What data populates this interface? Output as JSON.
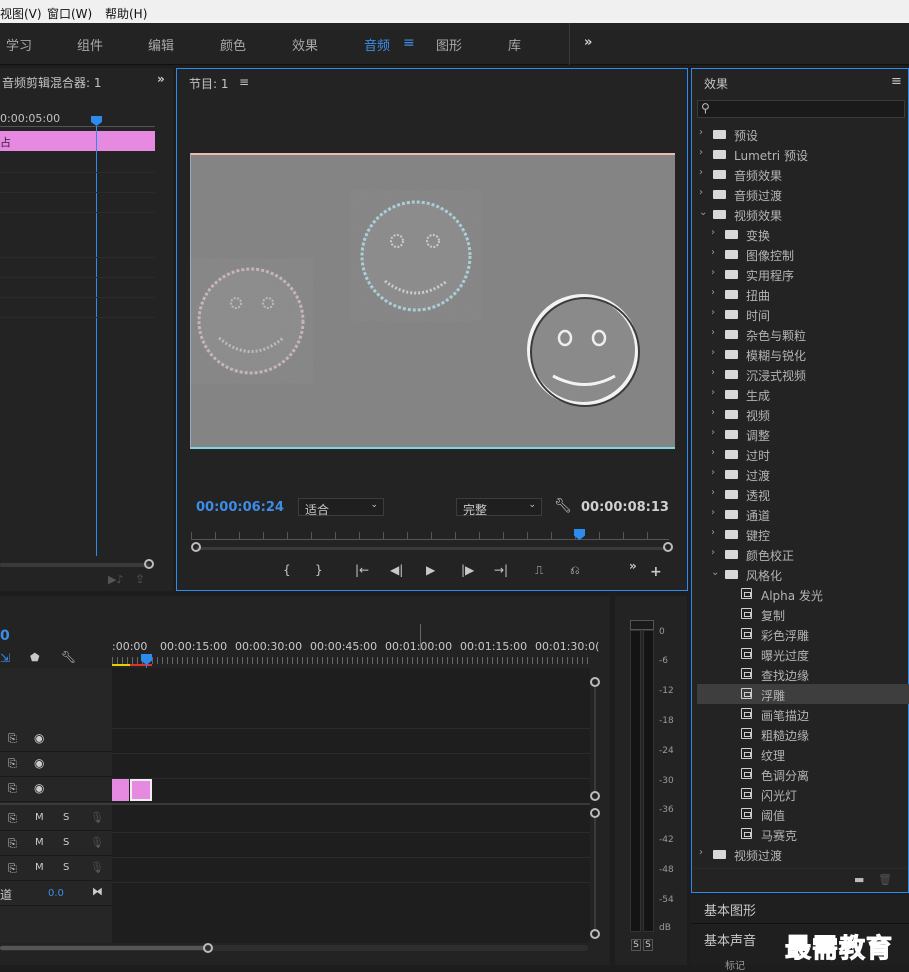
{
  "menubar": {
    "items": [
      "视图(V)",
      "窗口(W)",
      "帮助(H)"
    ]
  },
  "workspace": {
    "tabs": [
      "学习",
      "组件",
      "编辑",
      "颜色",
      "效果",
      "音频",
      "图形",
      "库"
    ],
    "active_tab": "音频",
    "menu_icon": "≡",
    "overflow_icon": "»"
  },
  "audio_mixer": {
    "title": "音频剪辑混合器: 1",
    "timecode": "0:00:05:00",
    "clip_label": "占"
  },
  "program_monitor": {
    "title": "节目: 1",
    "menu_icon": "≡",
    "current_timecode": "00:00:06:24",
    "zoom_select": "适合",
    "quality_select": "完整",
    "duration_timecode": "00:00:08:13",
    "controls": [
      "{",
      "}",
      "|←",
      "◀|",
      "▶",
      "|▶",
      "→|",
      "⎍",
      "⎌",
      "»",
      "+"
    ]
  },
  "timeline": {
    "timecode_fragment": "0",
    "ruler_labels": [
      ":00:00",
      "00:00:15:00",
      "00:00:30:00",
      "00:00:45:00",
      "00:01:00:00",
      "00:01:15:00",
      "00:01:30:0("
    ],
    "audio_track_buttons": [
      "M",
      "S"
    ],
    "master_label": "道",
    "master_value": "0.0"
  },
  "audio_meter": {
    "scale": [
      "0",
      "-6",
      "-12",
      "-18",
      "-24",
      "-30",
      "-36",
      "-42",
      "-48",
      "-54",
      "dB"
    ],
    "solo_buttons": [
      "S",
      "S"
    ]
  },
  "effects_panel": {
    "title": "效果",
    "menu_icon": "≡",
    "search_placeholder": "",
    "tree": [
      {
        "label": "预设",
        "level": 0,
        "kind": "folder-star",
        "expanded": false
      },
      {
        "label": "Lumetri 预设",
        "level": 0,
        "kind": "folder-star",
        "expanded": false
      },
      {
        "label": "音频效果",
        "level": 0,
        "kind": "folder",
        "expanded": false
      },
      {
        "label": "音频过渡",
        "level": 0,
        "kind": "folder",
        "expanded": false
      },
      {
        "label": "视频效果",
        "level": 0,
        "kind": "folder",
        "expanded": true
      },
      {
        "label": "变换",
        "level": 1,
        "kind": "folder",
        "expanded": false
      },
      {
        "label": "图像控制",
        "level": 1,
        "kind": "folder",
        "expanded": false
      },
      {
        "label": "实用程序",
        "level": 1,
        "kind": "folder",
        "expanded": false
      },
      {
        "label": "扭曲",
        "level": 1,
        "kind": "folder",
        "expanded": false
      },
      {
        "label": "时间",
        "level": 1,
        "kind": "folder",
        "expanded": false
      },
      {
        "label": "杂色与颗粒",
        "level": 1,
        "kind": "folder",
        "expanded": false
      },
      {
        "label": "模糊与锐化",
        "level": 1,
        "kind": "folder",
        "expanded": false
      },
      {
        "label": "沉浸式视频",
        "level": 1,
        "kind": "folder",
        "expanded": false
      },
      {
        "label": "生成",
        "level": 1,
        "kind": "folder",
        "expanded": false
      },
      {
        "label": "视频",
        "level": 1,
        "kind": "folder",
        "expanded": false
      },
      {
        "label": "调整",
        "level": 1,
        "kind": "folder",
        "expanded": false
      },
      {
        "label": "过时",
        "level": 1,
        "kind": "folder",
        "expanded": false
      },
      {
        "label": "过渡",
        "level": 1,
        "kind": "folder",
        "expanded": false
      },
      {
        "label": "透视",
        "level": 1,
        "kind": "folder",
        "expanded": false
      },
      {
        "label": "通道",
        "level": 1,
        "kind": "folder",
        "expanded": false
      },
      {
        "label": "键控",
        "level": 1,
        "kind": "folder",
        "expanded": false
      },
      {
        "label": "颜色校正",
        "level": 1,
        "kind": "folder",
        "expanded": false
      },
      {
        "label": "风格化",
        "level": 1,
        "kind": "folder",
        "expanded": true
      },
      {
        "label": "Alpha 发光",
        "level": 2,
        "kind": "effect"
      },
      {
        "label": "复制",
        "level": 2,
        "kind": "effect"
      },
      {
        "label": "彩色浮雕",
        "level": 2,
        "kind": "effect"
      },
      {
        "label": "曝光过度",
        "level": 2,
        "kind": "effect"
      },
      {
        "label": "查找边缘",
        "level": 2,
        "kind": "effect"
      },
      {
        "label": "浮雕",
        "level": 2,
        "kind": "effect",
        "selected": true
      },
      {
        "label": "画笔描边",
        "level": 2,
        "kind": "effect"
      },
      {
        "label": "粗糙边缘",
        "level": 2,
        "kind": "effect"
      },
      {
        "label": "纹理",
        "level": 2,
        "kind": "effect"
      },
      {
        "label": "色调分离",
        "level": 2,
        "kind": "effect"
      },
      {
        "label": "闪光灯",
        "level": 2,
        "kind": "effect"
      },
      {
        "label": "阈值",
        "level": 2,
        "kind": "effect"
      },
      {
        "label": "马赛克",
        "level": 2,
        "kind": "effect"
      },
      {
        "label": "视频过渡",
        "level": 0,
        "kind": "folder",
        "expanded": false
      }
    ]
  },
  "side_panels": [
    "基本图形",
    "基本声音",
    "标记"
  ],
  "watermark": "最需教育",
  "colors": {
    "accent": "#2d8ceb",
    "clip_pink": "#e58ae0",
    "selection": "#3e3e3e"
  }
}
